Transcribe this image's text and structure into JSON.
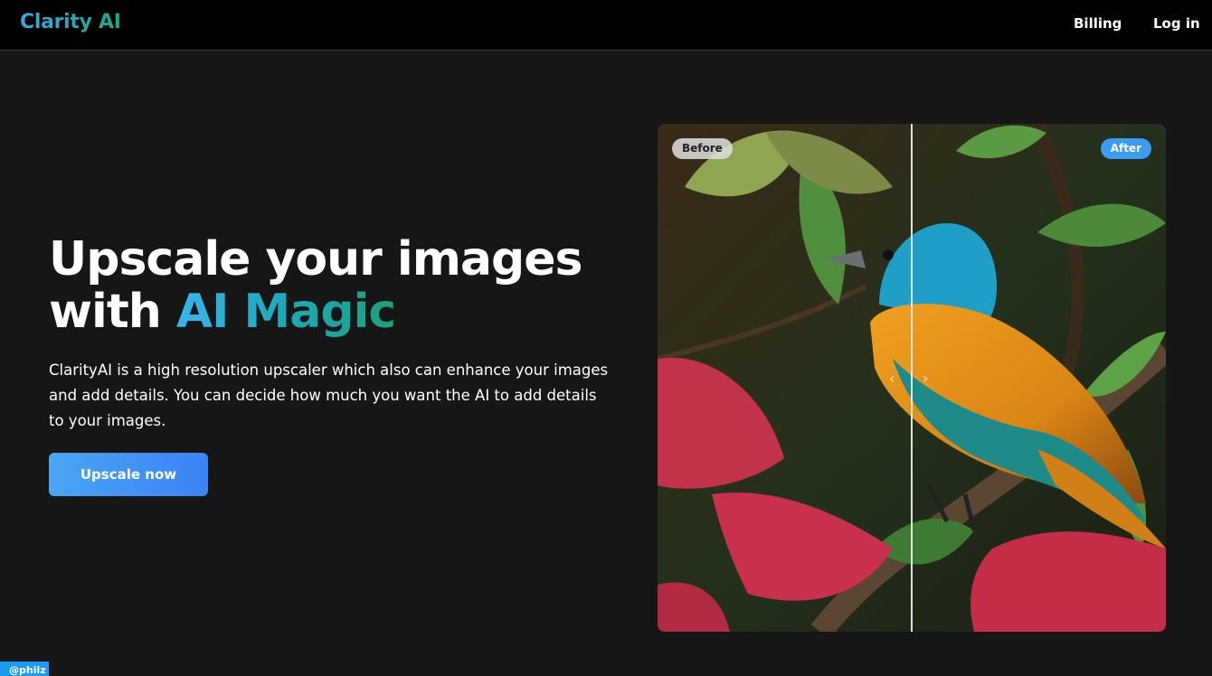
{
  "brand": {
    "name": "Clarity AI"
  },
  "nav": {
    "billing": "Billing",
    "login": "Log in"
  },
  "hero": {
    "title_line1": "Upscale your images",
    "title_with": "with ",
    "title_highlight": "AI Magic",
    "description": "ClarityAI is a high resolution upscaler which also can enhance your images and add details. You can decide how much you want the AI to add details to your images.",
    "cta_label": "Upscale now"
  },
  "comparison": {
    "before_label": "Before",
    "after_label": "After",
    "slider_position": 0.5
  },
  "credit": {
    "label": "@philz"
  },
  "colors": {
    "background": "#161616",
    "topbar": "#000000",
    "accent_blue": "#3b9cf2",
    "accent_teal": "#1aa884"
  },
  "icons": {
    "slider_left": "chevron-left-icon",
    "slider_right": "chevron-right-icon"
  }
}
